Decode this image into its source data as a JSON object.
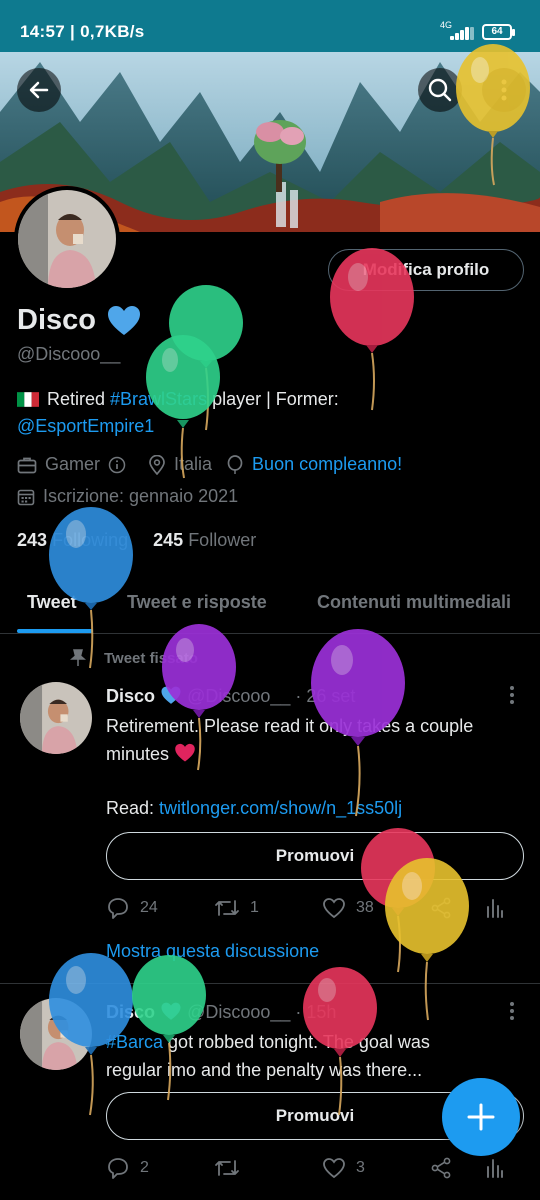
{
  "status_bar": {
    "time": "14:57 | 0,7KB/s",
    "network": "4G",
    "battery": "64"
  },
  "icons": {
    "back": "arrow-left-icon",
    "search": "search-icon",
    "more": "more-vertical-icon",
    "verified": "verified-heart-icon",
    "flag": "italy-flag-icon",
    "job": "briefcase-icon",
    "info": "info-icon",
    "location": "location-pin-icon",
    "birthday": "balloon-icon",
    "calendar": "calendar-icon",
    "pin": "pin-icon",
    "reply": "reply-icon",
    "retweet": "retweet-icon",
    "like": "heart-icon",
    "share": "share-icon",
    "analytics": "analytics-icon",
    "compose": "plus-icon"
  },
  "colors": {
    "accent": "#1d9bf0",
    "background": "#000000",
    "muted": "#71767b",
    "status_bar": "#0e7a8f"
  },
  "profile": {
    "edit_button": "Modifica profilo",
    "name": "Disco",
    "handle": "@Discooo__",
    "bio_prefix": "Retired ",
    "bio_hashtag": "#BrawlStars",
    "bio_middle": " player | Former:",
    "bio_mention": "@EsportEmpire1",
    "job": "Gamer",
    "location": "Italia",
    "birthday": "Buon compleanno!",
    "joined": "Iscrizione: gennaio 2021",
    "following_count": "243",
    "following_label": "Following",
    "followers_count": "245",
    "followers_label": "Follower"
  },
  "tabs": [
    {
      "label": "Tweet",
      "active": true
    },
    {
      "label": "Tweet e risposte",
      "active": false
    },
    {
      "label": "Contenuti multimediali",
      "active": false
    }
  ],
  "tweets": [
    {
      "pinned_label": "Tweet fissato",
      "name": "Disco",
      "handle": "@Discooo__",
      "time": "· 26 set",
      "text_line1": "Retirement. Please read it only takes a couple",
      "text_line2": "minutes",
      "link_prefix": "Read: ",
      "link": "twitlonger.com/show/n_1ss50lj",
      "promote": "Promuovi",
      "replies": "24",
      "retweets": "1",
      "likes": "38",
      "thread": "Mostra questa discussione"
    },
    {
      "name": "Disco",
      "handle": "@Discooo__",
      "time": "· 15h",
      "hashtag": "#Barca",
      "text_line1": " got robbed tonight. The goal was",
      "text_line2": "regular imo and the penalty was there...",
      "promote": "Promuovi",
      "replies": "2",
      "retweets": "",
      "likes": "3"
    }
  ],
  "balloon_colors": [
    "#e8c22e",
    "#2fd38c",
    "#e8365c",
    "#2f8fe0",
    "#9b30d8"
  ]
}
